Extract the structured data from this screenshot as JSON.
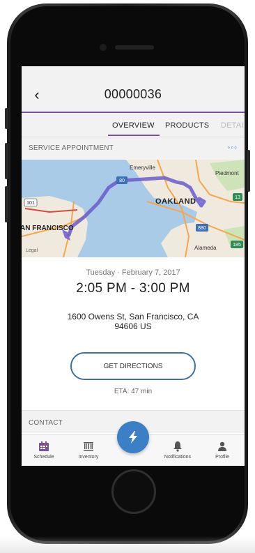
{
  "header": {
    "back_icon": "chevron-left-icon",
    "title": "00000036"
  },
  "tabs": [
    {
      "label": "OVERVIEW",
      "active": true
    },
    {
      "label": "PRODUCTS",
      "active": false
    },
    {
      "label": "DETAI",
      "active": false
    }
  ],
  "section": {
    "label": "SERVICE APPOINTMENT",
    "more_icon": "more-dots-icon"
  },
  "map": {
    "places": [
      "Emeryville",
      "Piedmont",
      "OAKLAND",
      "AN FRANCISCO",
      "Alameda",
      "Legal"
    ],
    "highways": [
      "80",
      "101",
      "13",
      "880",
      "185"
    ],
    "route_color": "#6a5acd"
  },
  "appointment": {
    "date": "Tuesday · February 7, 2017",
    "time": "2:05 PM - 3:00 PM",
    "address_line1": "1600 Owens St, San Francisco, CA",
    "address_line2": "94606 US",
    "directions_label": "GET DIRECTIONS",
    "eta": "ETA: 47 min"
  },
  "contact": {
    "label": "CONTACT"
  },
  "tab_bar": [
    {
      "label": "Schedule",
      "icon": "calendar-icon",
      "active": true
    },
    {
      "label": "Inventory",
      "icon": "barcode-icon",
      "active": false
    },
    {
      "label": "",
      "icon": "lightning-icon",
      "active": false
    },
    {
      "label": "Notifications",
      "icon": "bell-icon",
      "active": false
    },
    {
      "label": "Profile",
      "icon": "person-icon",
      "active": false
    }
  ],
  "colors": {
    "accent": "#7a4fa0",
    "button_border": "#3d6fa8",
    "fab": "#3b80c6"
  }
}
